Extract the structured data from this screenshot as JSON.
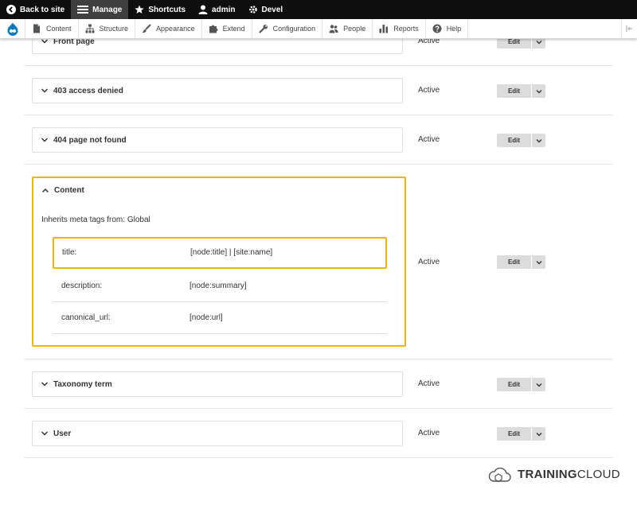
{
  "toolbar": {
    "back_to_site": "Back to site",
    "manage": "Manage",
    "shortcuts": "Shortcuts",
    "user": "admin",
    "devel": "Devel"
  },
  "tray": {
    "items": [
      "Content",
      "Structure",
      "Appearance",
      "Extend",
      "Configuration",
      "People",
      "Reports",
      "Help"
    ]
  },
  "rows": [
    {
      "label": "Front page",
      "status": "Active",
      "edit": "Edit"
    },
    {
      "label": "403 access denied",
      "status": "Active",
      "edit": "Edit"
    },
    {
      "label": "404 page not found",
      "status": "Active",
      "edit": "Edit"
    },
    {
      "label": "Content",
      "status": "Active",
      "edit": "Edit"
    },
    {
      "label": "Taxonomy term",
      "status": "Active",
      "edit": "Edit"
    },
    {
      "label": "User",
      "status": "Active",
      "edit": "Edit"
    }
  ],
  "content_details": {
    "inherits": "Inherits meta tags from: Global",
    "tags": [
      {
        "key": "title:",
        "value": "[node:title] | [site:name]"
      },
      {
        "key": "description:",
        "value": "[node:summary]"
      },
      {
        "key": "canonical_url:",
        "value": "[node:url]"
      }
    ]
  },
  "brand": {
    "bold": "TRAINING",
    "rest": "CLOUD"
  },
  "colors": {
    "highlight": "#f0b400",
    "toolbar_bg": "#0f0f0f",
    "drupal_blue": "#0678be"
  }
}
